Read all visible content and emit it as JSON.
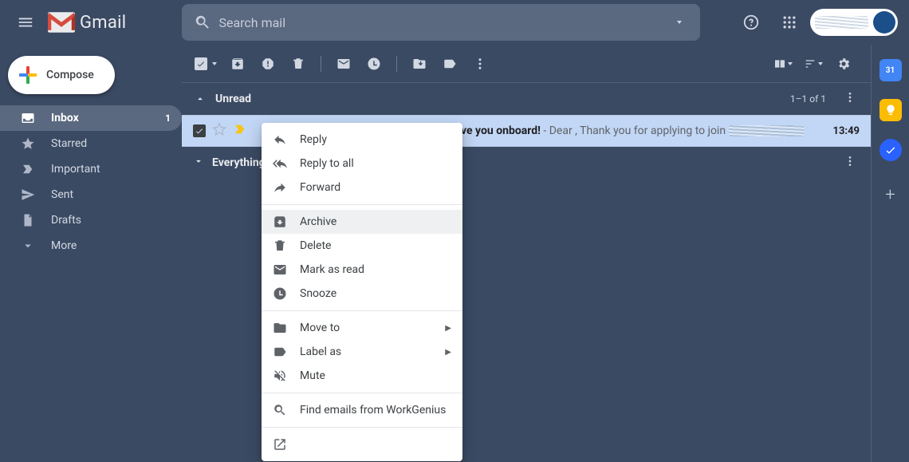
{
  "header": {
    "product": "Gmail",
    "search_placeholder": "Search mail"
  },
  "compose_label": "Compose",
  "sidebar": {
    "items": [
      {
        "label": "Inbox",
        "count": "1",
        "active": true
      },
      {
        "label": "Starred"
      },
      {
        "label": "Important"
      },
      {
        "label": "Sent"
      },
      {
        "label": "Drafts"
      },
      {
        "label": "More"
      }
    ]
  },
  "toolbar_icons": [
    "select",
    "archive",
    "spam",
    "delete",
    "mark-read",
    "snooze",
    "move-to",
    "label",
    "more"
  ],
  "sections": {
    "unread": {
      "title": "Unread",
      "count": "1–1 of 1"
    },
    "everything": {
      "title": "Everything else"
    }
  },
  "email": {
    "subject_bold_suffix": "ve you onboard!",
    "snippet_prefix": " - Dear , Thank you for applying to join ",
    "time": "13:49",
    "sender": "WorkGenius"
  },
  "context_menu": {
    "items": [
      {
        "id": "reply",
        "label": "Reply"
      },
      {
        "id": "reply-all",
        "label": "Reply to all"
      },
      {
        "id": "forward",
        "label": "Forward"
      },
      {
        "sep": true
      },
      {
        "id": "archive",
        "label": "Archive",
        "hover": true
      },
      {
        "id": "delete",
        "label": "Delete"
      },
      {
        "id": "mark-read",
        "label": "Mark as read"
      },
      {
        "id": "snooze",
        "label": "Snooze"
      },
      {
        "sep": true
      },
      {
        "id": "move-to",
        "label": "Move to",
        "submenu": true
      },
      {
        "id": "label-as",
        "label": "Label as",
        "submenu": true
      },
      {
        "id": "mute",
        "label": "Mute"
      },
      {
        "sep": true
      },
      {
        "id": "find-from",
        "label": "Find emails from WorkGenius"
      },
      {
        "sep": true
      },
      {
        "id": "open-window",
        "label": "Open in new window"
      }
    ]
  },
  "right_panel": {
    "calendar_day": "31"
  },
  "colors": {
    "bg": "#3b4a63",
    "row_selected": "#c2d6f5",
    "accent_blue": "#4285f4",
    "accent_yellow": "#fbbc04"
  }
}
